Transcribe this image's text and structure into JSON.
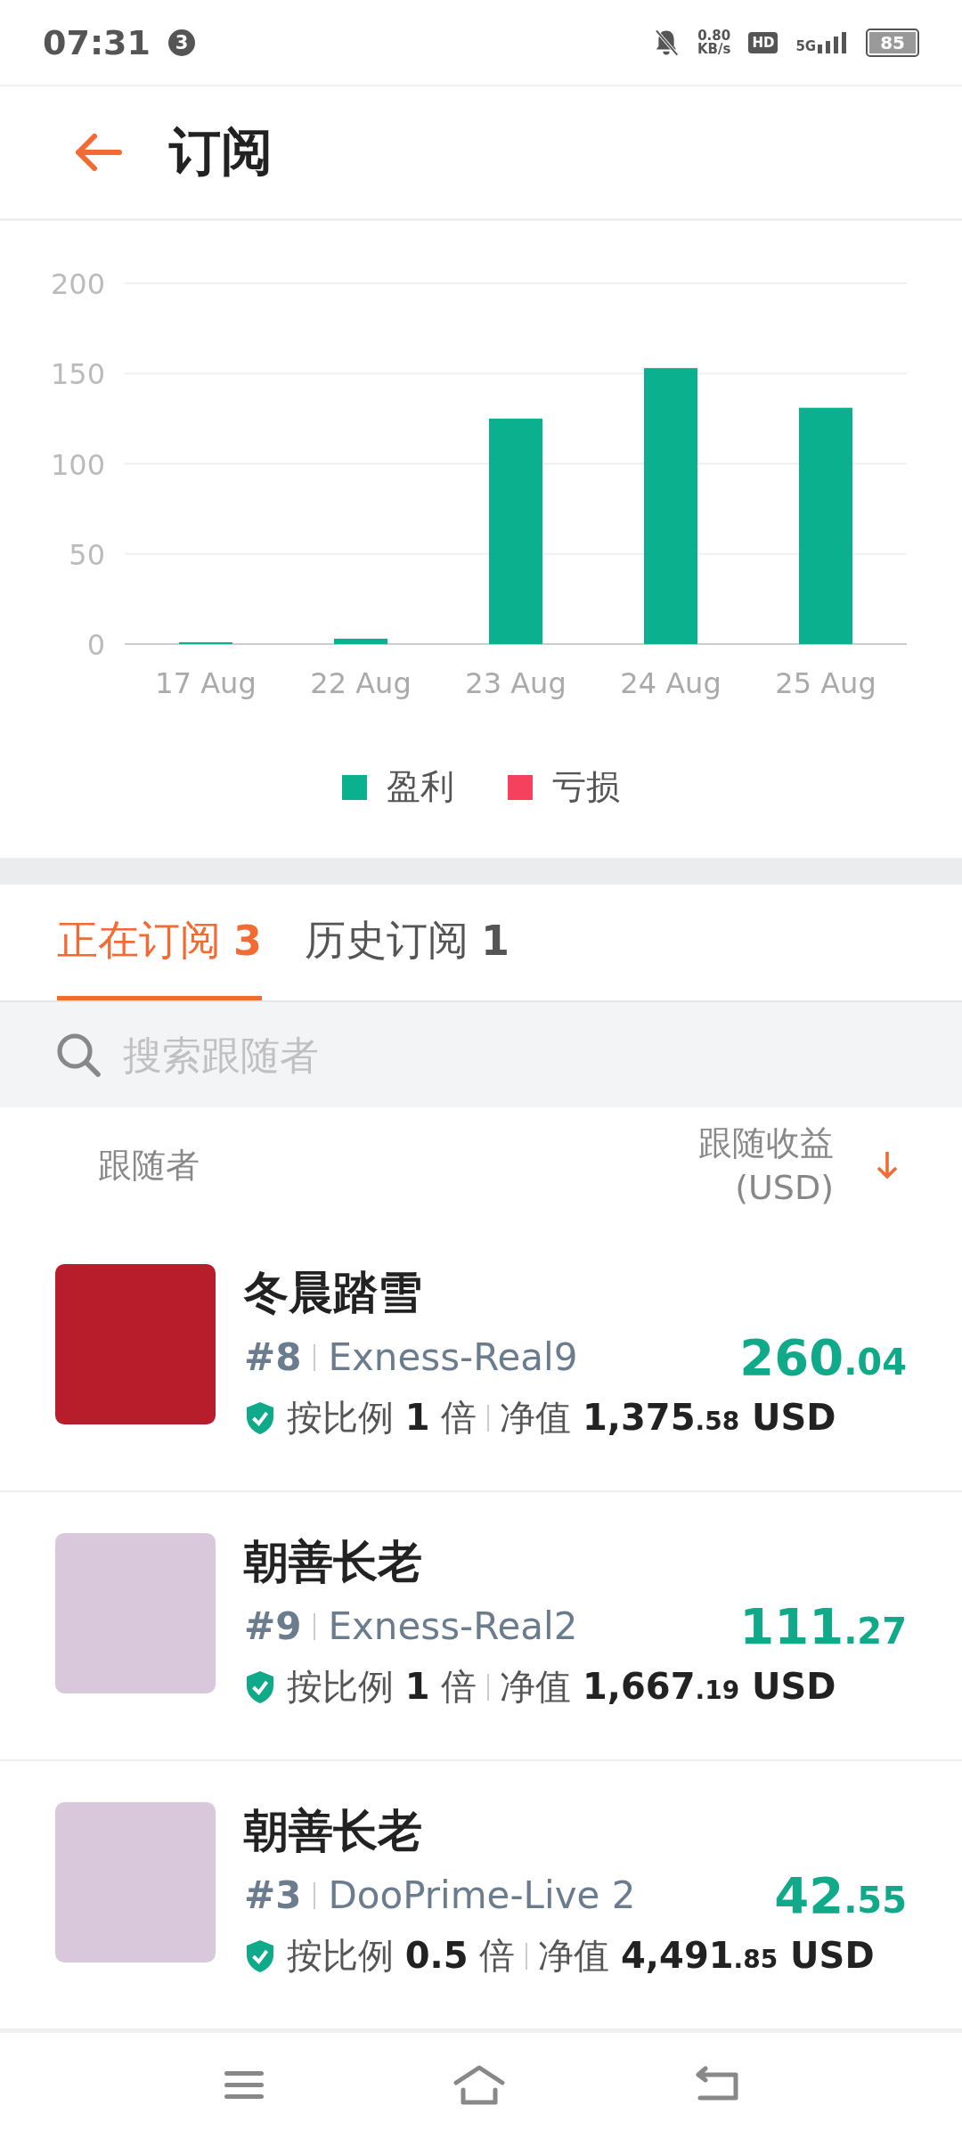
{
  "status_bar": {
    "time": "07:31",
    "notification_count": "3",
    "net_speed": "0.80",
    "net_unit": "KB/s",
    "hd": "HD",
    "network": "5G",
    "battery": "85"
  },
  "header": {
    "title": "订阅"
  },
  "chart": {
    "chart_data": {
      "type": "bar",
      "categories": [
        "17 Aug",
        "22 Aug",
        "23 Aug",
        "24 Aug",
        "25 Aug"
      ],
      "yticks": [
        0,
        50,
        100,
        150,
        200
      ],
      "ylim": [
        0,
        200
      ],
      "grid": true,
      "series": [
        {
          "name": "盈利",
          "color": "#0bb08f",
          "values": [
            1,
            3,
            125,
            153,
            131
          ]
        },
        {
          "name": "亏损",
          "color": "#f5405e",
          "values": [
            0,
            0,
            0,
            0,
            0
          ]
        }
      ]
    }
  },
  "tabs": [
    {
      "label": "正在订阅",
      "count": "3",
      "selected": true
    },
    {
      "label": "历史订阅",
      "count": "1",
      "selected": false
    }
  ],
  "search": {
    "placeholder": "搜索跟随者"
  },
  "columns": {
    "follower": "跟随者",
    "profit": "跟随收益",
    "profit_unit": "(USD)"
  },
  "followers": [
    {
      "name": "冬晨踏雪",
      "rank": "#8",
      "server": "Exness-Real9",
      "profit": "260.04",
      "ratio_label": "按比例",
      "ratio": "1",
      "ratio_unit": "倍",
      "equity_label": "净值",
      "equity": "1,375.58",
      "currency": "USD",
      "color": "#b81d2b"
    },
    {
      "name": "朝善长老",
      "rank": "#9",
      "server": "Exness-Real2",
      "profit": "111.27",
      "ratio_label": "按比例",
      "ratio": "1",
      "ratio_unit": "倍",
      "equity_label": "净值",
      "equity": "1,667.19",
      "currency": "USD",
      "color": "#d9c8dc"
    },
    {
      "name": "朝善长老",
      "rank": "#3",
      "server": "DooPrime-Live 2",
      "profit": "42.55",
      "ratio_label": "按比例",
      "ratio": "0.5",
      "ratio_unit": "倍",
      "equity_label": "净值",
      "equity": "4,491.85",
      "currency": "USD",
      "color": "#d9c8dc"
    }
  ]
}
